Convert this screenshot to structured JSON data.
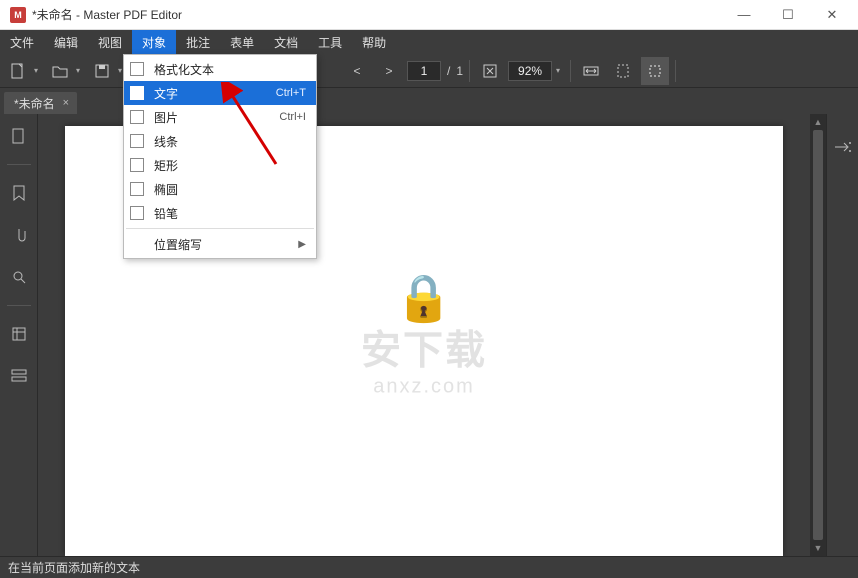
{
  "window": {
    "title": "*未命名 - Master PDF Editor",
    "app_abbrev": "M"
  },
  "menu": {
    "items": [
      "文件",
      "编辑",
      "视图",
      "对象",
      "批注",
      "表单",
      "文档",
      "工具",
      "帮助"
    ],
    "active_index": 3
  },
  "dropdown": {
    "items": [
      {
        "label": "格式化文本",
        "checkbox": true,
        "shortcut": ""
      },
      {
        "label": "文字",
        "checkbox": true,
        "shortcut": "Ctrl+T",
        "selected": true
      },
      {
        "label": "图片",
        "checkbox": true,
        "shortcut": "Ctrl+I"
      },
      {
        "label": "线条",
        "checkbox": true,
        "shortcut": ""
      },
      {
        "label": "矩形",
        "checkbox": true,
        "shortcut": ""
      },
      {
        "label": "椭圆",
        "checkbox": true,
        "shortcut": ""
      },
      {
        "label": "铅笔",
        "checkbox": true,
        "shortcut": ""
      }
    ],
    "separator_after": 6,
    "submenu": {
      "label": "位置缩写"
    }
  },
  "toolbar": {
    "page_current": "1",
    "page_sep": "/",
    "page_total": "1",
    "zoom_value": "92%"
  },
  "tab": {
    "name": "*未命名",
    "close": "×"
  },
  "watermark": {
    "big": "安下载",
    "small": "anxz.com"
  },
  "status": {
    "text": "在当前页面添加新的文本"
  },
  "winbtn": {
    "min": "—",
    "max": "☐",
    "close": "✕"
  }
}
